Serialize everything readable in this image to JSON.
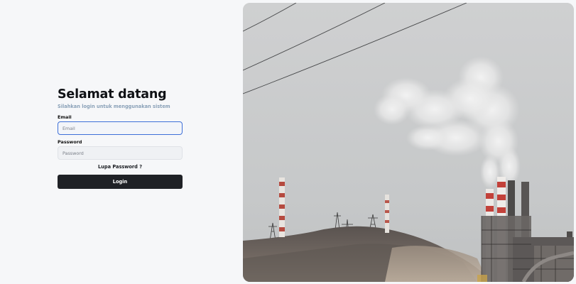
{
  "login": {
    "title": "Selamat datang",
    "subtitle": "Silahkan login untuk menggunakan sistem",
    "email_label": "Email",
    "email_placeholder": "Email",
    "email_value": "",
    "password_label": "Password",
    "password_placeholder": "Password",
    "password_value": "",
    "forgot_label": "Lupa Password ?",
    "submit_label": "Login"
  },
  "colors": {
    "page_background": "#f6f7f9",
    "subtitle": "#8aa1b8",
    "focus_border": "#3d6fd8",
    "button_background": "#1f2126",
    "button_text": "#ffffff"
  },
  "photo": {
    "subject": "factory-smokestacks-image"
  }
}
